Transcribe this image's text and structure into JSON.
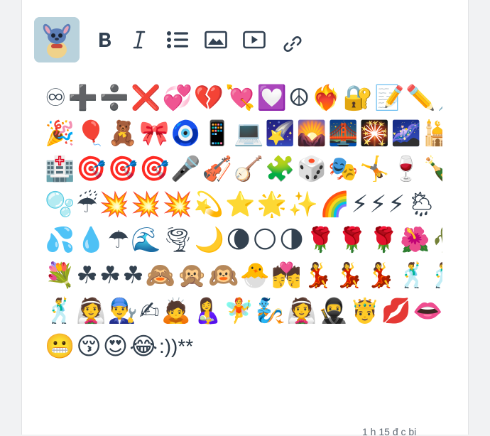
{
  "toolbar": {
    "avatar_icon": "avatar-stitch-image",
    "bold_icon": "bold-icon",
    "italic_icon": "italic-icon",
    "list_icon": "bulleted-list-icon",
    "image_icon": "image-icon",
    "video_icon": "video-icon",
    "link_icon": "link-icon"
  },
  "editor": {
    "rows": [
      "♾➕➗❌💞💔💘💟☮❤️‍🔥🔐📝✏️📌",
      "🎉🎈🧸🎀🧿📱💻🌠🌄🌉🎇🌌🕌🕋",
      "🏥🎯🎯🎯🎤🎻🪕🧩🎲🎭🤸🍷🍾☕",
      "🫧☔💥💥💥💫⭐🌟✨🌈⚡⚡⚡🌦",
      "💦💧☂🌊🌪🌙🌘🌕🌗🌹🌹🌹🌺🥀",
      "💐☘☘☘🙈🙊🙉🐣💏💃💃💃🕺🕺",
      "🕺👰👨‍🔧✍🙇🤱🧚🧞👰🥷🤴💋👄🥴",
      "😬😚😍😂"
    ],
    "tail_text": ":))**",
    "partial_text": "1 h 15 đ c bi"
  },
  "colors": {
    "icon": "#324152",
    "avatar_bg": "#b9d2dc",
    "card_bg": "#ffffff",
    "page_bg": "#f1f2f3"
  }
}
